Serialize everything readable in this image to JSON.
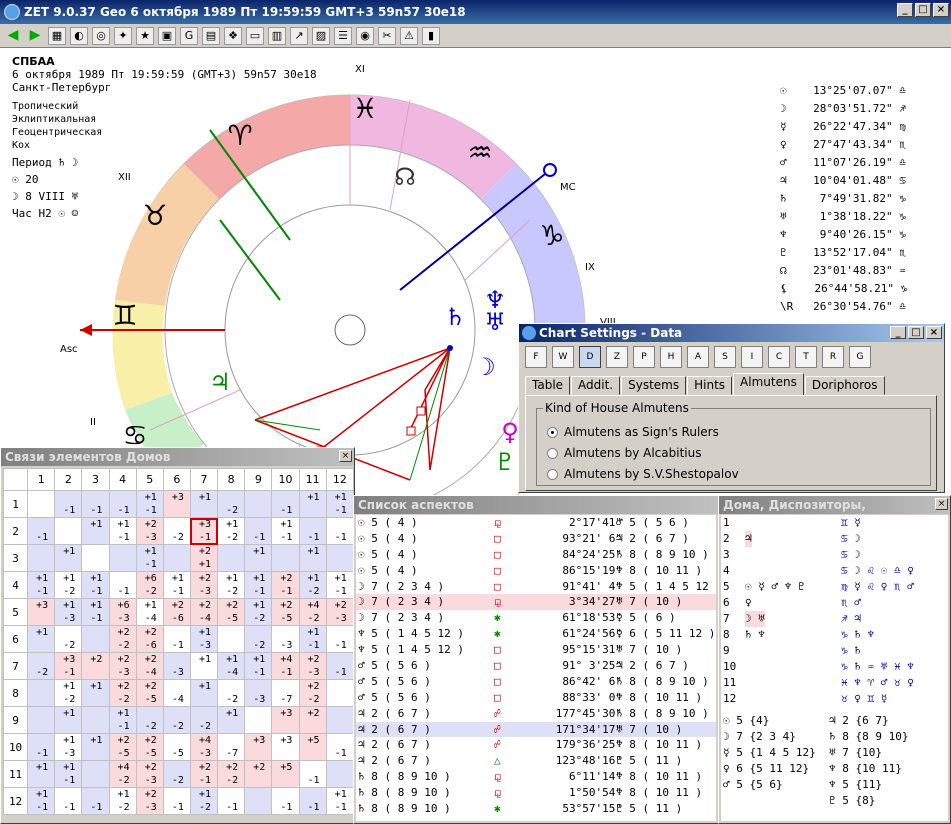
{
  "window": {
    "title": "ZET 9.0.37 Geo    6 октября 1989  Пт  19:59:59 GMT+3 59n57  30e18"
  },
  "chart_info": {
    "name": "СПБАА",
    "line2": "6 октября 1989  Пт  19:59:59 (GMT+3) 59n57  30e18",
    "city": "Санкт-Петербург",
    "zodiac": "Тропический",
    "coords": "Эклиптикальная",
    "center": "Геоцентрическая",
    "houses": "Кох",
    "period": "Период ♄ ☽",
    "sun": "☉  20",
    "moon": "☽  8 VIII ♅",
    "hour": "Час Н2 ☉ ☺"
  },
  "wheel_labels": {
    "asc": "Asc",
    "mc": "MC",
    "h2": "II",
    "h8": "VIII",
    "h9": "IX",
    "h11": "XI",
    "h12": "XII"
  },
  "planets": [
    {
      "g": "☉",
      "pos": "13°25'07.07\"",
      "s": "♎"
    },
    {
      "g": "☽",
      "pos": "28°03'51.72\"",
      "s": "♐"
    },
    {
      "g": "☿",
      "pos": "26°22'47.34\"",
      "s": "♍"
    },
    {
      "g": "♀",
      "pos": "27°47'43.34\"",
      "s": "♏"
    },
    {
      "g": "♂",
      "pos": "11°07'26.19\"",
      "s": "♎"
    },
    {
      "g": "♃",
      "pos": "10°04'01.48\"",
      "s": "♋"
    },
    {
      "g": "♄",
      "pos": "7°49'31.82\"",
      "s": "♑"
    },
    {
      "g": "♅",
      "pos": "1°38'18.22\"",
      "s": "♑"
    },
    {
      "g": "♆",
      "pos": "9°40'26.15\"",
      "s": "♑"
    },
    {
      "g": "♇",
      "pos": "13°52'17.04\"",
      "s": "♏"
    },
    {
      "g": "☊",
      "pos": "23°01'48.83\"",
      "s": "♒"
    },
    {
      "g": "⚸",
      "pos": "26°44'58.21\"",
      "s": "♑"
    },
    {
      "g": "\\R",
      "pos": "26°30'54.76\"",
      "s": "♎"
    }
  ],
  "houses_window": {
    "title": "Связи элементов Домов",
    "cols": [
      "1",
      "2",
      "3",
      "4",
      "5",
      "6",
      "7",
      "8",
      "9",
      "10",
      "11",
      "12"
    ]
  },
  "aspects_window": {
    "title": "Список аспектов",
    "rows": [
      [
        "☉ 5 ( 4 )",
        "⚼",
        "2°17'41\"",
        "♂ 5 ( 5 6 )"
      ],
      [
        "☉ 5 ( 4 )",
        "□",
        "93°21' 6\"",
        "♃ 2 ( 6 7 )"
      ],
      [
        "☉ 5 ( 4 )",
        "□",
        "84°24'25\"",
        "♄ 8 ( 8 9 10 )"
      ],
      [
        "☉ 5 ( 4 )",
        "□",
        "86°15'19\"",
        "♆ 8 ( 10 11 )"
      ],
      [
        "☽ 7 ( 2 3 4 )",
        "□",
        "91°41' 4\"",
        "♆ 5 ( 1 4 5 12 )"
      ],
      [
        "☽ 7 ( 2 3 4 )",
        "⚼",
        "3°34'27\"",
        "♅ 7 ( 10 )"
      ],
      [
        "☽ 7 ( 2 3 4 )",
        "✱",
        "61°18'53\"",
        "♀ 5 ( 6 )"
      ],
      [
        "♆ 5 ( 1 4 5 12 )",
        "✱",
        "61°24'56\"",
        "♀ 6 ( 5 11 12 )"
      ],
      [
        "♆ 5 ( 1 4 5 12 )",
        "□",
        "95°15'31\"",
        "♅ 7 ( 10 )"
      ],
      [
        "♂ 5 ( 5 6 )",
        "□",
        "91° 3'25\"",
        "♃ 2 ( 6 7 )"
      ],
      [
        "♂ 5 ( 5 6 )",
        "□",
        "86°42' 6\"",
        "♄ 8 ( 8 9 10 )"
      ],
      [
        "♂ 5 ( 5 6 )",
        "□",
        "88°33' 0\"",
        "♆ 8 ( 10 11 )"
      ],
      [
        "♃ 2 ( 6 7 )",
        "☍",
        "177°45'30\"",
        "♄ 8 ( 8 9 10 )"
      ],
      [
        "♃ 2 ( 6 7 )",
        "☍",
        "171°34'17\"",
        "♅ 7 ( 10 )"
      ],
      [
        "♃ 2 ( 6 7 )",
        "☍",
        "179°36'25\"",
        "♆ 8 ( 10 11 )"
      ],
      [
        "♃ 2 ( 6 7 )",
        "△",
        "123°48'16\"",
        "♇ 5 ( 11 )"
      ],
      [
        "♄ 8 ( 8 9 10 )",
        "⚼",
        "6°11'14\"",
        "♆ 8 ( 10 11 )"
      ],
      [
        "♄ 8 ( 8 9 10 )",
        "⚼",
        "1°50'54\"",
        "♆ 8 ( 10 11 )"
      ],
      [
        "♄ 8 ( 8 9 10 )",
        "✱",
        "53°57'15\"",
        "♇ 5 ( 11 )"
      ]
    ]
  },
  "disp_window": {
    "title": "Дома, Диспозиторы, Управление",
    "rows": [
      {
        "n": "1",
        "a": "",
        "b": "♊ ☿"
      },
      {
        "n": "2",
        "a": "♃",
        "b": "♋ ☽"
      },
      {
        "n": "3",
        "a": "",
        "b": "♋ ☽"
      },
      {
        "n": "4",
        "a": "",
        "b": "♋ ☽ ♌ ☉ ♎ ♀"
      },
      {
        "n": "5",
        "a": "☉ ☿ ♂ ♆ ♇",
        "b": "♍ ☿ ♌ ♀ ♏ ♂"
      },
      {
        "n": "6",
        "a": "♀",
        "b": "♏ ♂"
      },
      {
        "n": "7",
        "a": "☽ ♅",
        "b": "♐ ♃"
      },
      {
        "n": "8",
        "a": "♄ ♆",
        "b": "♑ ♄   ♆"
      },
      {
        "n": "9",
        "a": "",
        "b": "♑ ♄"
      },
      {
        "n": "10",
        "a": "",
        "b": "♑ ♄ ♒ ♅ ♓ ♆"
      },
      {
        "n": "11",
        "a": "",
        "b": "♓ ♆ ♈ ♂ ♉ ♀"
      },
      {
        "n": "12",
        "a": "",
        "b": "♉ ♀ ♊ ☿"
      }
    ],
    "bottom": [
      [
        "☉ 5 {4}",
        "♃ 2 {6 7}"
      ],
      [
        "☽ 7 {2 3 4}",
        "♄ 8 {8 9 10}"
      ],
      [
        "☿ 5 {1 4 5 12}",
        "♅ 7 {10}"
      ],
      [
        "♀ 6 {5 11 12}",
        "♆ 8 {10 11}"
      ],
      [
        "♂ 5 {5 6}",
        "♆ 5 {11}"
      ],
      [
        "",
        "♇ 5 {8}"
      ]
    ]
  },
  "settings": {
    "title": "Chart Settings - Data",
    "tabs": [
      "Table",
      "Addit.",
      "Systems",
      "Hints",
      "Almutens",
      "Doriphoros"
    ],
    "group_label": "Kind of House Almutens",
    "options": [
      "Almutens as Sign's Rulers",
      "Almutens by Alcabitius",
      "Almutens by S.V.Shestopalov"
    ],
    "selected": 0,
    "icons": [
      "F",
      "W",
      "D",
      "Z",
      "P",
      "H",
      "A",
      "S",
      "I",
      "C",
      "T",
      "R",
      "G"
    ]
  }
}
